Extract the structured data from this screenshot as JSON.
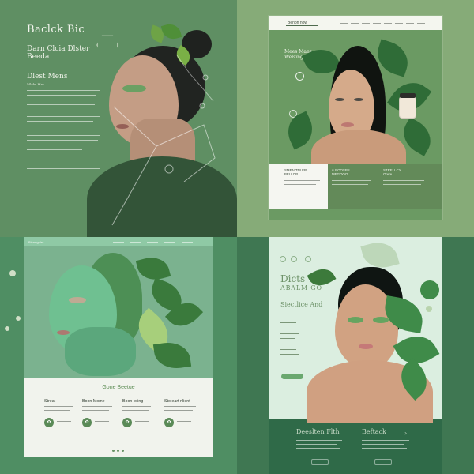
{
  "tiles": {
    "q1": {
      "title": "Baclck Bic",
      "subtitle_line1": "Darn Clcia Dlster",
      "subtitle_line2": "Beeda",
      "section_title": "Dlest Mens",
      "section_label": "Mleks Mer"
    },
    "q2": {
      "brand": "Benon now",
      "hero_title_line1": "Mees Mans",
      "hero_title_line2": "Welsing ld.",
      "col1_line1": "SMEN TNLER",
      "col1_line2": "BELLOP",
      "col2_line1": "& BOOSPS",
      "col2_line2": "MEGOOO",
      "col3_line1": "STRELLCY",
      "col3_line2": "Orere"
    },
    "q3": {
      "brand": "Blermgeler",
      "headline": "Gone Beetue",
      "col1": "Streat",
      "col2": "Boon Mome",
      "col3": "Boon loling",
      "col4": "Sto eart nlient"
    },
    "q4": {
      "title_line1": "Dicts",
      "title_line2": "ABALM GO",
      "subtitle": "Siectlice And",
      "bottom_left": "Deeslten Flth",
      "bottom_right": "Beftack"
    }
  },
  "colors": {
    "q1_bg": "#5f8f63",
    "q2_bg": "#86ab78",
    "q3_bg": "#4f8e63",
    "q4_bg": "#3f7752"
  }
}
